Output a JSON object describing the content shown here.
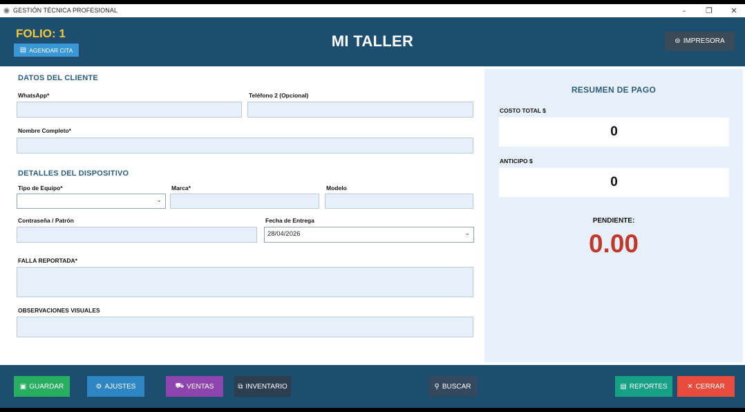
{
  "window": {
    "title": "GESTIÓN TÉCNICA PROFESIONAL",
    "controls": {
      "minimize": "–",
      "restore": "❐",
      "close": "✕"
    }
  },
  "header": {
    "folio": "FOLIO: 1",
    "agendar_label": "AGENDAR CITA",
    "app_title": "MI TALLER",
    "impresora_label": "IMPRESORA",
    "colors": {
      "bar": "#1d4e6f",
      "folio": "#f6c932"
    }
  },
  "cliente": {
    "section_title": "DATOS DEL CLIENTE",
    "whatsapp_label": "WhatsApp*",
    "whatsapp_value": "",
    "telefono2_label": "Teléfono 2 (Opcional)",
    "telefono2_value": "",
    "nombre_label": "Nombre Completo*",
    "nombre_value": ""
  },
  "dispositivo": {
    "section_title": "DETALLES DEL DISPOSITIVO",
    "tipo_label": "Tipo de Equipo*",
    "tipo_value": "",
    "marca_label": "Marca*",
    "modelo_label": "Modelo",
    "password_label": "Contraseña / Patrón",
    "fecha_label": "Fecha de Entrega",
    "fecha_value": "28/04/2026",
    "falla_label": "FALLA REPORTADA*",
    "obs_label": "OBSERVACIONES VISUALES"
  },
  "resumen": {
    "title": "RESUMEN DE PAGO",
    "costo_label": "COSTO TOTAL $",
    "costo_value": "0",
    "anticipo_label": "ANTICIPO $",
    "anticipo_value": "0",
    "pendiente_label": "PENDIENTE:",
    "pendiente_value": "0.00",
    "pendiente_color": "#c0392b"
  },
  "footer": {
    "guardar": "GUARDAR",
    "ajustes": "AJUSTES",
    "ventas": "VENTAS",
    "inventario": "INVENTARIO",
    "buscar": "BUSCAR",
    "reportes": "REPORTES",
    "cerrar": "CERRAR",
    "colors": {
      "guardar": "#27ae60",
      "ajustes": "#2f86c4",
      "ventas": "#8e44ad",
      "inventario": "#2c3e50",
      "buscar": "#34495e",
      "reportes": "#16a085",
      "cerrar": "#e74c3c"
    }
  }
}
